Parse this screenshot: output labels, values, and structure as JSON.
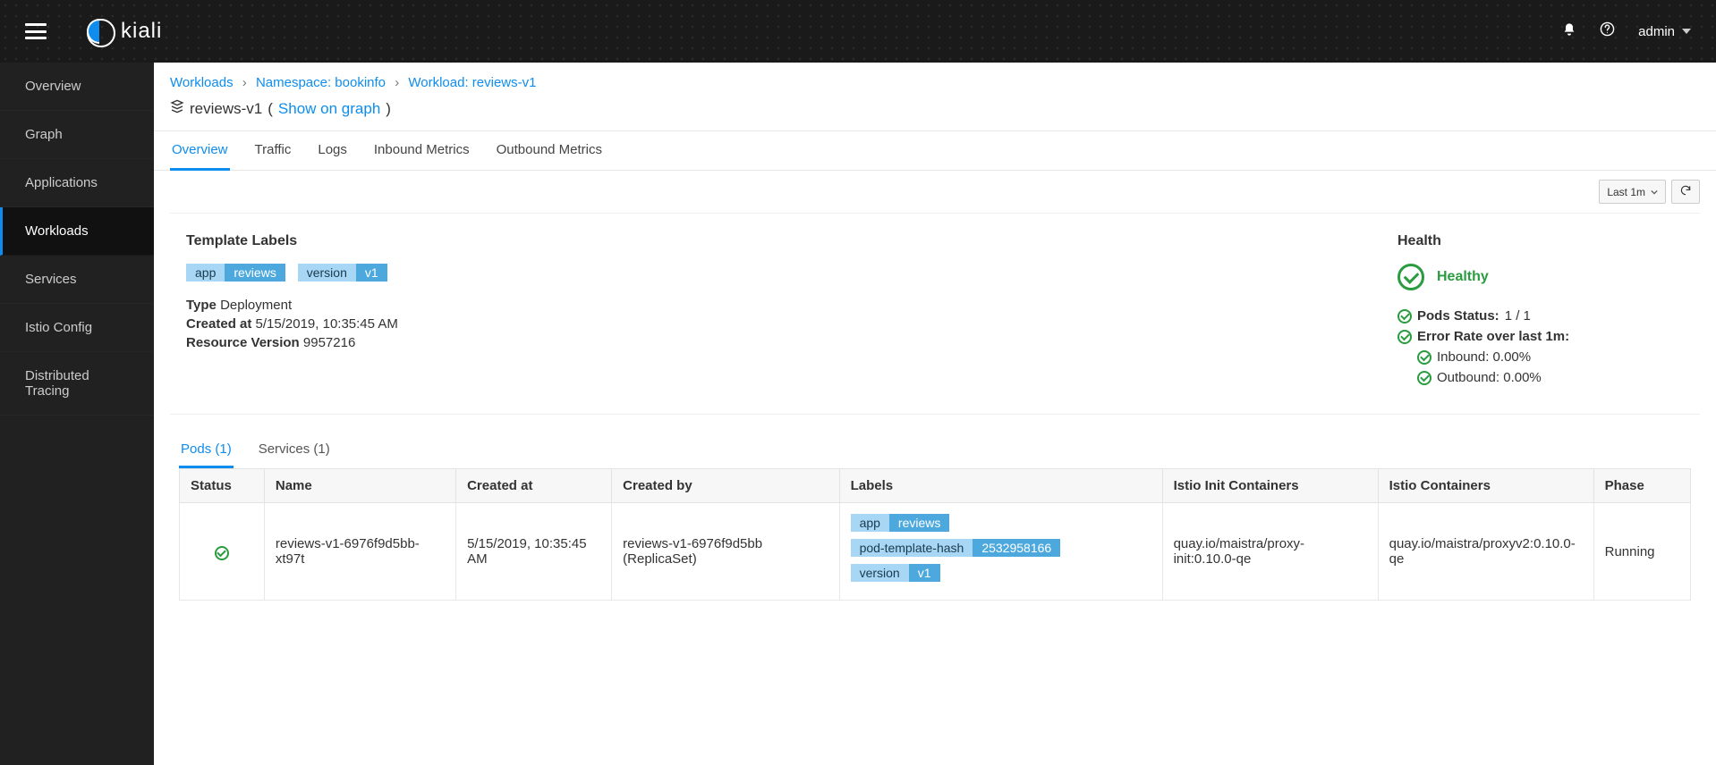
{
  "header": {
    "brand": "kiali",
    "user": "admin"
  },
  "sidebar": {
    "items": [
      {
        "label": "Overview"
      },
      {
        "label": "Graph"
      },
      {
        "label": "Applications"
      },
      {
        "label": "Workloads",
        "active": true
      },
      {
        "label": "Services"
      },
      {
        "label": "Istio Config"
      },
      {
        "label": "Distributed Tracing"
      }
    ]
  },
  "breadcrumbs": {
    "root": "Workloads",
    "namespace": "Namespace: bookinfo",
    "workload": "Workload: reviews-v1"
  },
  "page": {
    "title": "reviews-v1",
    "show_on_graph": "Show on graph"
  },
  "tabs": {
    "overview": "Overview",
    "traffic": "Traffic",
    "logs": "Logs",
    "inbound": "Inbound Metrics",
    "outbound": "Outbound Metrics"
  },
  "toolbar": {
    "time_range": "Last 1m"
  },
  "template_labels": {
    "heading": "Template Labels",
    "labels": [
      {
        "k": "app",
        "v": "reviews"
      },
      {
        "k": "version",
        "v": "v1"
      }
    ],
    "type_k": "Type",
    "type_v": "Deployment",
    "created_k": "Created at",
    "created_v": "5/15/2019, 10:35:45 AM",
    "rv_k": "Resource Version",
    "rv_v": "9957216"
  },
  "health": {
    "heading": "Health",
    "status": "Healthy",
    "pods_label": "Pods Status:",
    "pods_value": "1 / 1",
    "error_rate_label": "Error Rate over last 1m:",
    "inbound": "Inbound: 0.00%",
    "outbound": "Outbound: 0.00%"
  },
  "subtabs": {
    "pods": "Pods (1)",
    "services": "Services (1)"
  },
  "pods_table": {
    "headers": {
      "status": "Status",
      "name": "Name",
      "created_at": "Created at",
      "created_by": "Created by",
      "labels": "Labels",
      "init_containers": "Istio Init Containers",
      "containers": "Istio Containers",
      "phase": "Phase"
    },
    "row": {
      "name": "reviews-v1-6976f9d5bb-xt97t",
      "created_at": "5/15/2019, 10:35:45 AM",
      "created_by": "reviews-v1-6976f9d5bb (ReplicaSet)",
      "labels": [
        {
          "k": "app",
          "v": "reviews"
        },
        {
          "k": "pod-template-hash",
          "v": "2532958166"
        },
        {
          "k": "version",
          "v": "v1"
        }
      ],
      "init_containers": "quay.io/maistra/proxy-init:0.10.0-qe",
      "containers": "quay.io/maistra/proxyv2:0.10.0-qe",
      "phase": "Running"
    }
  }
}
